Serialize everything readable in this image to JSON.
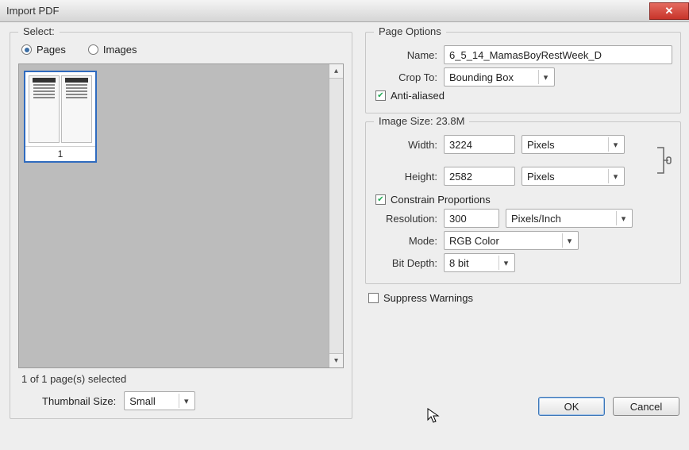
{
  "window": {
    "title": "Import PDF"
  },
  "select": {
    "legend": "Select:",
    "page_radio": "Pages",
    "image_radio": "Images",
    "page_number": "1",
    "selected_status": "1 of 1 page(s) selected",
    "thumb_size_label": "Thumbnail Size:",
    "thumb_size_value": "Small"
  },
  "page_options": {
    "legend": "Page Options",
    "name_label": "Name:",
    "name_value": "6_5_14_MamasBoyRestWeek_D",
    "crop_label": "Crop To:",
    "crop_value": "Bounding Box",
    "anti_aliased_label": "Anti-aliased"
  },
  "image_size": {
    "legend_prefix": "Image Size: ",
    "size_text": "23.8M",
    "width_label": "Width:",
    "width_value": "3224",
    "width_units": "Pixels",
    "height_label": "Height:",
    "height_value": "2582",
    "height_units": "Pixels",
    "constrain_label": "Constrain Proportions",
    "resolution_label": "Resolution:",
    "resolution_value": "300",
    "resolution_units": "Pixels/Inch",
    "mode_label": "Mode:",
    "mode_value": "RGB Color",
    "bitdepth_label": "Bit Depth:",
    "bitdepth_value": "8 bit"
  },
  "suppress_warnings_label": "Suppress Warnings",
  "buttons": {
    "ok": "OK",
    "cancel": "Cancel"
  }
}
